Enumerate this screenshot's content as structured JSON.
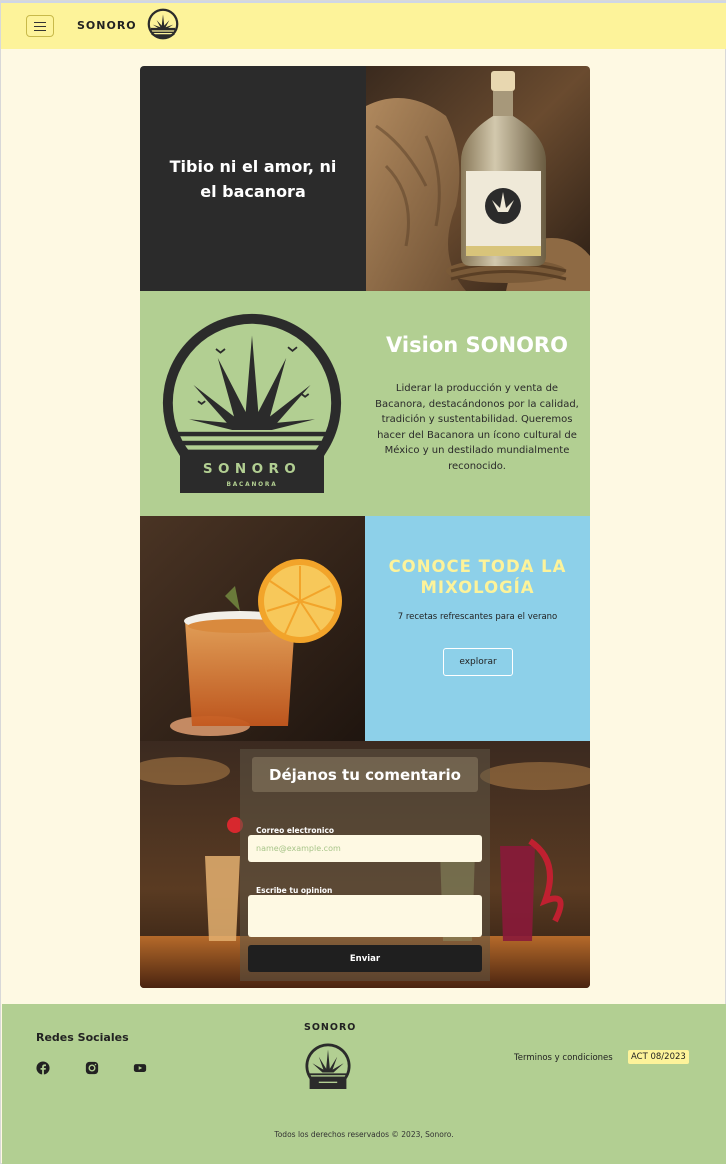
{
  "nav": {
    "brand": "SONORO",
    "menu_icon": "hamburger-menu-icon",
    "logo_icon": "agave-logo-icon"
  },
  "hero": {
    "title": "Tibio ni el amor, ni el bacanora",
    "image": "bacanora-bottle-photo"
  },
  "vision": {
    "title": "Vision SONORO",
    "text": "Liderar la producción y venta de Bacanora, destacándonos por la calidad, tradición y sustentabilidad. Queremos hacer del Bacanora un ícono cultural de México y un destilado mundialmente reconocido.",
    "logo_brand": "SONORO",
    "logo_sub": "BACANORA"
  },
  "mixology": {
    "title": "CONOCE TODA LA MIXOLOGÍA",
    "subtitle": "7 recetas refrescantes para el verano",
    "button": "explorar",
    "image": "cocktail-photo"
  },
  "comment_form": {
    "title": "Déjanos tu comentario",
    "email_label": "Correo electronico",
    "email_placeholder": "name@example.com",
    "opinion_label": "Escribe tu opinion",
    "submit": "Enviar",
    "background": "bar-cocktails-photo"
  },
  "footer": {
    "social_title": "Redes Sociales",
    "social_icons": [
      "facebook-icon",
      "instagram-icon",
      "youtube-icon"
    ],
    "brand": "SONORO",
    "terms": "Terminos y condiciones",
    "badge": "ACT 08/2023",
    "copyright": "Todos los derechos reservados © 2023, Sonoro."
  },
  "colors": {
    "page_bg": "#fef9e3",
    "nav_bg": "#fdf39a",
    "green": "#b2cf92",
    "dark": "#2b2b2b",
    "blue": "#8dd0e9",
    "yellow_text": "#fdf39a"
  }
}
